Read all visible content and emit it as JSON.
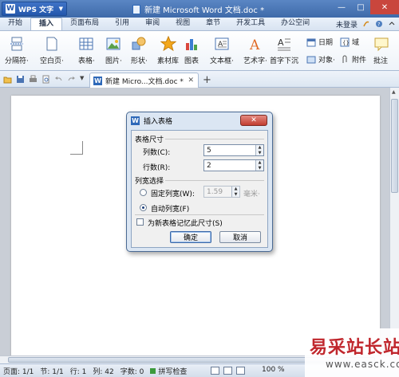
{
  "titlebar": {
    "app_name": "WPS 文字",
    "app_logo": "W",
    "doc_title": "新建 Microsoft Word 文档.doc *",
    "controls": [
      "—",
      "□",
      "✕"
    ]
  },
  "menu": {
    "tabs": [
      "开始",
      "插入",
      "页面布局",
      "引用",
      "审阅",
      "视图",
      "章节",
      "开发工具",
      "办公空间"
    ],
    "active_tab": "插入",
    "login": "未登录"
  },
  "ribbon": {
    "items": [
      {
        "label": "分隔符·",
        "icon": "page-break-icon"
      },
      {
        "label": "空白页·",
        "icon": "blank-page-icon"
      },
      {
        "label": "表格·",
        "icon": "table-icon"
      },
      {
        "label": "图片·",
        "icon": "picture-icon"
      },
      {
        "label": "形状·",
        "icon": "shape-icon"
      },
      {
        "label": "素材库",
        "icon": "star-icon"
      },
      {
        "label": "图表",
        "icon": "chart-icon"
      },
      {
        "label": "文本框·",
        "icon": "textbox-icon"
      },
      {
        "label": "艺术字·",
        "icon": "wordart-icon"
      },
      {
        "label": "首字下沉",
        "icon": "dropcap-icon"
      }
    ],
    "small_items": [
      {
        "label": "日期",
        "icon": "calendar-icon"
      },
      {
        "label": "域",
        "icon": "field-icon"
      },
      {
        "label": "对象·",
        "icon": "object-icon"
      },
      {
        "label": "附件",
        "icon": "attachment-icon"
      }
    ],
    "cut_label": "批注"
  },
  "doc_tab": {
    "icon": "W",
    "label": "新建 Micro...文档.doc *",
    "close": "✕",
    "new_tab": "+"
  },
  "dialog": {
    "icon": "W",
    "title": "插入表格",
    "close": "✕",
    "size_group": "表格尺寸",
    "cols_label": "列数(C):",
    "cols_value": "5",
    "rows_label": "行数(R):",
    "rows_value": "2",
    "width_group": "列宽选择",
    "fixed_label": "固定列宽(W):",
    "fixed_value": "1.59",
    "unit": "毫米·",
    "auto_label": "自动列宽(F)",
    "remember_label": "为新表格记忆此尺寸(S)",
    "ok": "确定",
    "cancel": "取消",
    "selected_width_mode": "auto",
    "remember_checked": false
  },
  "status": {
    "page": "页面: 1/1",
    "section": "节: 1/1",
    "line": "行: 1",
    "column": "列: 42",
    "words": "字数: 0",
    "spell": "拼写检查",
    "zoom": "100 %"
  },
  "watermark": {
    "cn": "易采站长站",
    "en": "www.easck.com"
  },
  "colors": {
    "titlebar": "#3e6aa9",
    "accent": "#2d68b8",
    "close_red": "#c23d30",
    "watermark_red": "#c0272d"
  }
}
